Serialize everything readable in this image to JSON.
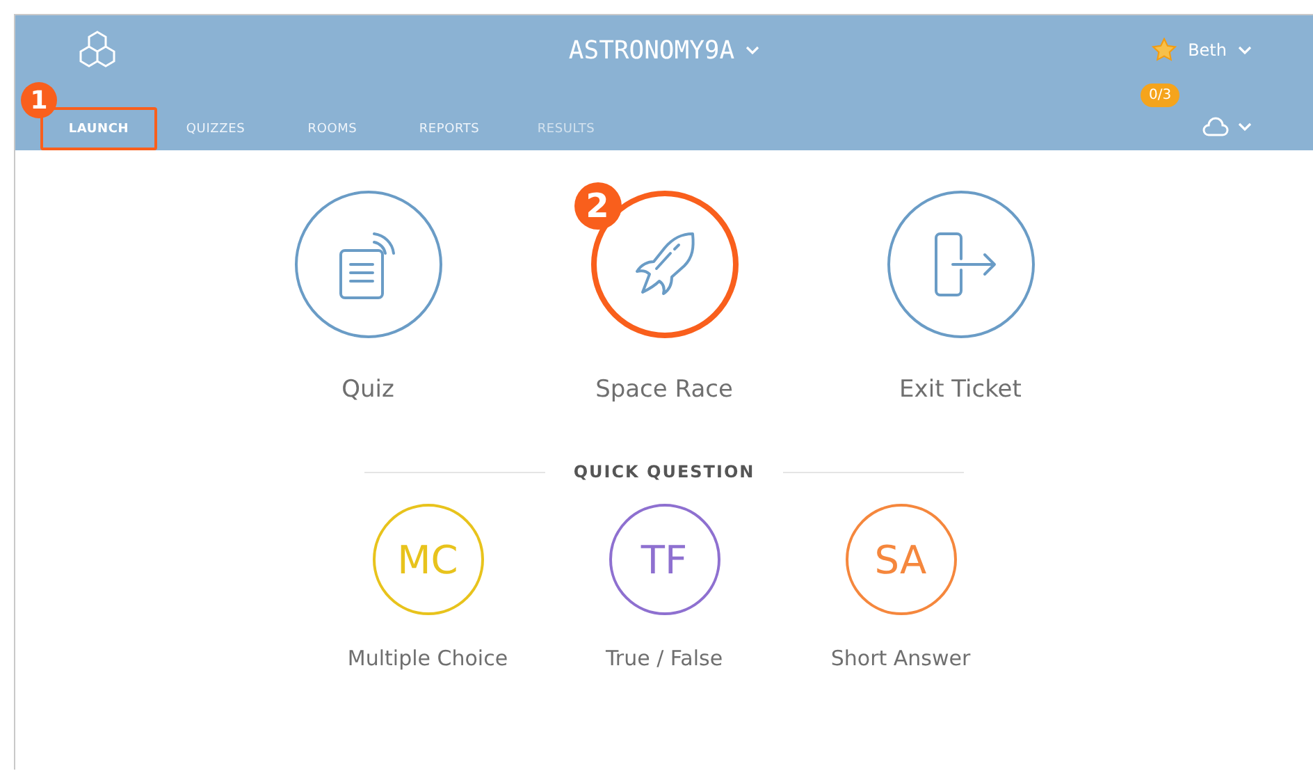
{
  "header": {
    "title": "ASTRONOMY9A",
    "user": "Beth",
    "badge": "0/3"
  },
  "tabs": [
    {
      "label": "LAUNCH",
      "selected": true,
      "disabled": false,
      "callout": "1"
    },
    {
      "label": "QUIZZES",
      "selected": false,
      "disabled": false
    },
    {
      "label": "ROOMS",
      "selected": false,
      "disabled": false
    },
    {
      "label": "REPORTS",
      "selected": false,
      "disabled": false
    },
    {
      "label": "RESULTS",
      "selected": false,
      "disabled": true
    }
  ],
  "activities": [
    {
      "label": "Quiz",
      "kind": "quiz"
    },
    {
      "label": "Space Race",
      "kind": "rocket",
      "callout": "2"
    },
    {
      "label": "Exit Ticket",
      "kind": "exit"
    }
  ],
  "quick_question": {
    "heading": "QUICK QUESTION",
    "items": [
      {
        "abbr": "MC",
        "label": "Multiple Choice",
        "color": "#e8c31c"
      },
      {
        "abbr": "TF",
        "label": "True / False",
        "color": "#8e70d0"
      },
      {
        "abbr": "SA",
        "label": "Short Answer",
        "color": "#f5873d"
      }
    ]
  }
}
